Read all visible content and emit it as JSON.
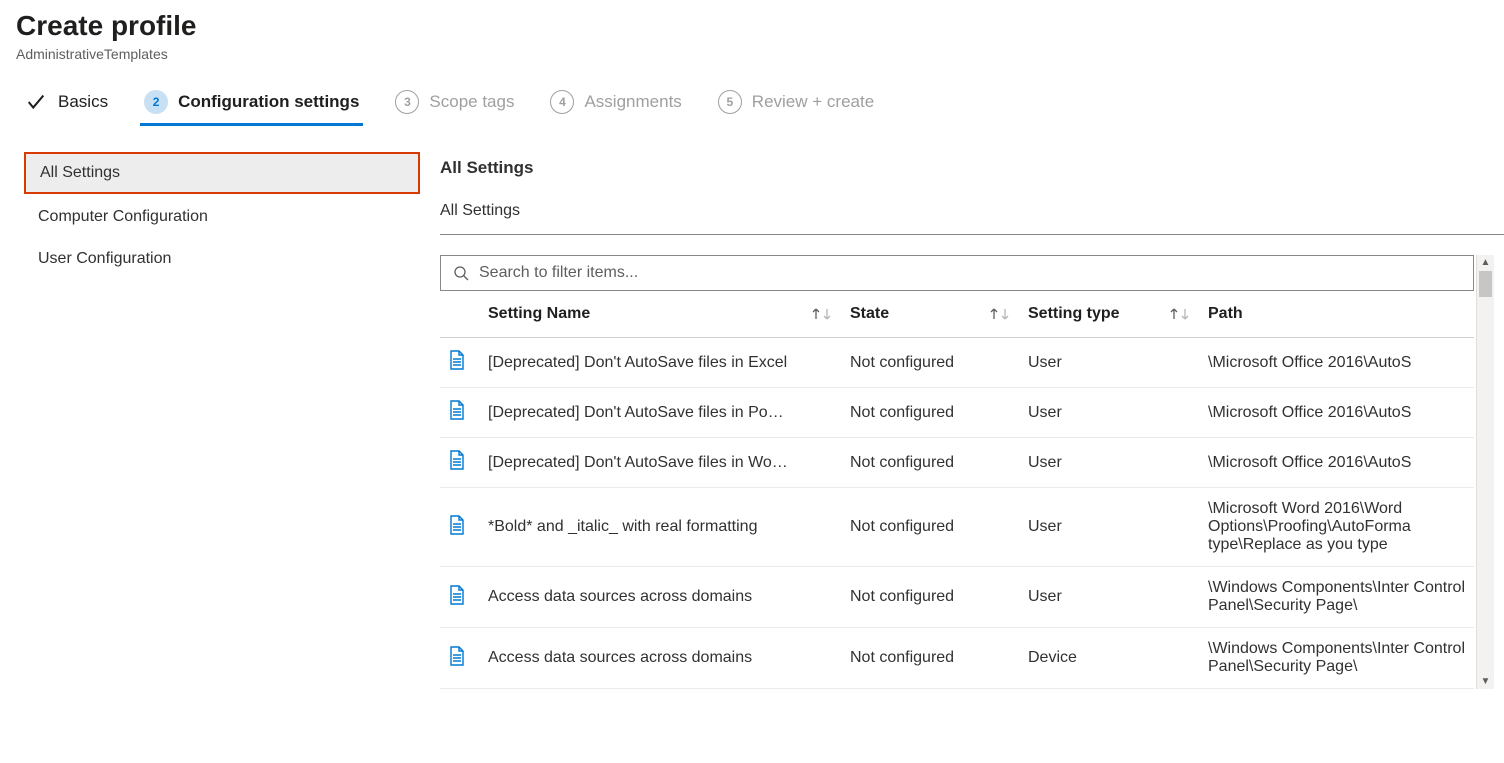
{
  "header": {
    "title": "Create profile",
    "subtitle": "AdministrativeTemplates"
  },
  "wizard": {
    "steps": [
      {
        "label": "Basics",
        "state": "done"
      },
      {
        "label": "Configuration settings",
        "state": "active",
        "num": "2"
      },
      {
        "label": "Scope tags",
        "state": "future",
        "num": "3"
      },
      {
        "label": "Assignments",
        "state": "future",
        "num": "4"
      },
      {
        "label": "Review + create",
        "state": "future",
        "num": "5"
      }
    ]
  },
  "tree": {
    "items": [
      {
        "label": "All Settings",
        "selected": true
      },
      {
        "label": "Computer Configuration",
        "selected": false
      },
      {
        "label": "User Configuration",
        "selected": false
      }
    ]
  },
  "content": {
    "section_title": "All Settings",
    "breadcrumb": "All Settings",
    "search_placeholder": "Search to filter items...",
    "columns": {
      "name": "Setting Name",
      "state": "State",
      "type": "Setting type",
      "path": "Path"
    },
    "rows": [
      {
        "name": "[Deprecated] Don't AutoSave files in Excel",
        "state": "Not configured",
        "type": "User",
        "path": "\\Microsoft Office 2016\\AutoS"
      },
      {
        "name": "[Deprecated] Don't AutoSave files in Po…",
        "state": "Not configured",
        "type": "User",
        "path": "\\Microsoft Office 2016\\AutoS"
      },
      {
        "name": "[Deprecated] Don't AutoSave files in Wo…",
        "state": "Not configured",
        "type": "User",
        "path": "\\Microsoft Office 2016\\AutoS"
      },
      {
        "name": "*Bold* and _italic_ with real formatting",
        "state": "Not configured",
        "type": "User",
        "path": "\\Microsoft Word 2016\\Word Options\\Proofing\\AutoForma type\\Replace as you type"
      },
      {
        "name": "Access data sources across domains",
        "state": "Not configured",
        "type": "User",
        "path": "\\Windows Components\\Inter Control Panel\\Security Page\\"
      },
      {
        "name": "Access data sources across domains",
        "state": "Not configured",
        "type": "Device",
        "path": "\\Windows Components\\Inter Control Panel\\Security Page\\"
      }
    ]
  }
}
